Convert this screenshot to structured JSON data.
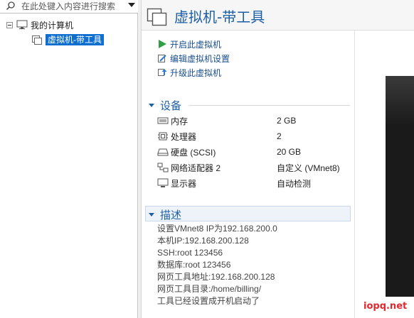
{
  "search": {
    "placeholder": "在此处键入内容进行搜索"
  },
  "tree": {
    "root_label": "我的计算机",
    "child_label": "虚拟机-带工具"
  },
  "header": {
    "title": "虚拟机-带工具"
  },
  "actions": [
    {
      "label": "开启此虚拟机",
      "icon": "play-icon"
    },
    {
      "label": "编辑虚拟机设置",
      "icon": "edit-settings-icon"
    },
    {
      "label": "升级此虚拟机",
      "icon": "upgrade-icon"
    }
  ],
  "devices": {
    "heading": "设备",
    "items": [
      {
        "name": "内存",
        "value": "2 GB",
        "icon": "memory-icon"
      },
      {
        "name": "处理器",
        "value": "2",
        "icon": "cpu-icon"
      },
      {
        "name": "硬盘 (SCSI)",
        "value": "20 GB",
        "icon": "harddisk-icon"
      },
      {
        "name": "网络适配器 2",
        "value": "自定义 (VMnet8)",
        "icon": "network-icon"
      },
      {
        "name": "显示器",
        "value": "自动检测",
        "icon": "monitor-icon"
      }
    ]
  },
  "description": {
    "heading": "描述",
    "lines": [
      "设置VMnet8 IP为192.168.200.0",
      "本机IP:192.168.200.128",
      "SSH:root 123456",
      "数据库:root 123456",
      "网页工具地址:192.168.200.128",
      "网页工具目录:/home/billing/",
      "工具已经设置成开机启动了"
    ]
  },
  "watermark": "iopq.net",
  "colors": {
    "accent": "#1c5fa6",
    "selection": "#0f6fd0",
    "play": "#2ea043"
  }
}
